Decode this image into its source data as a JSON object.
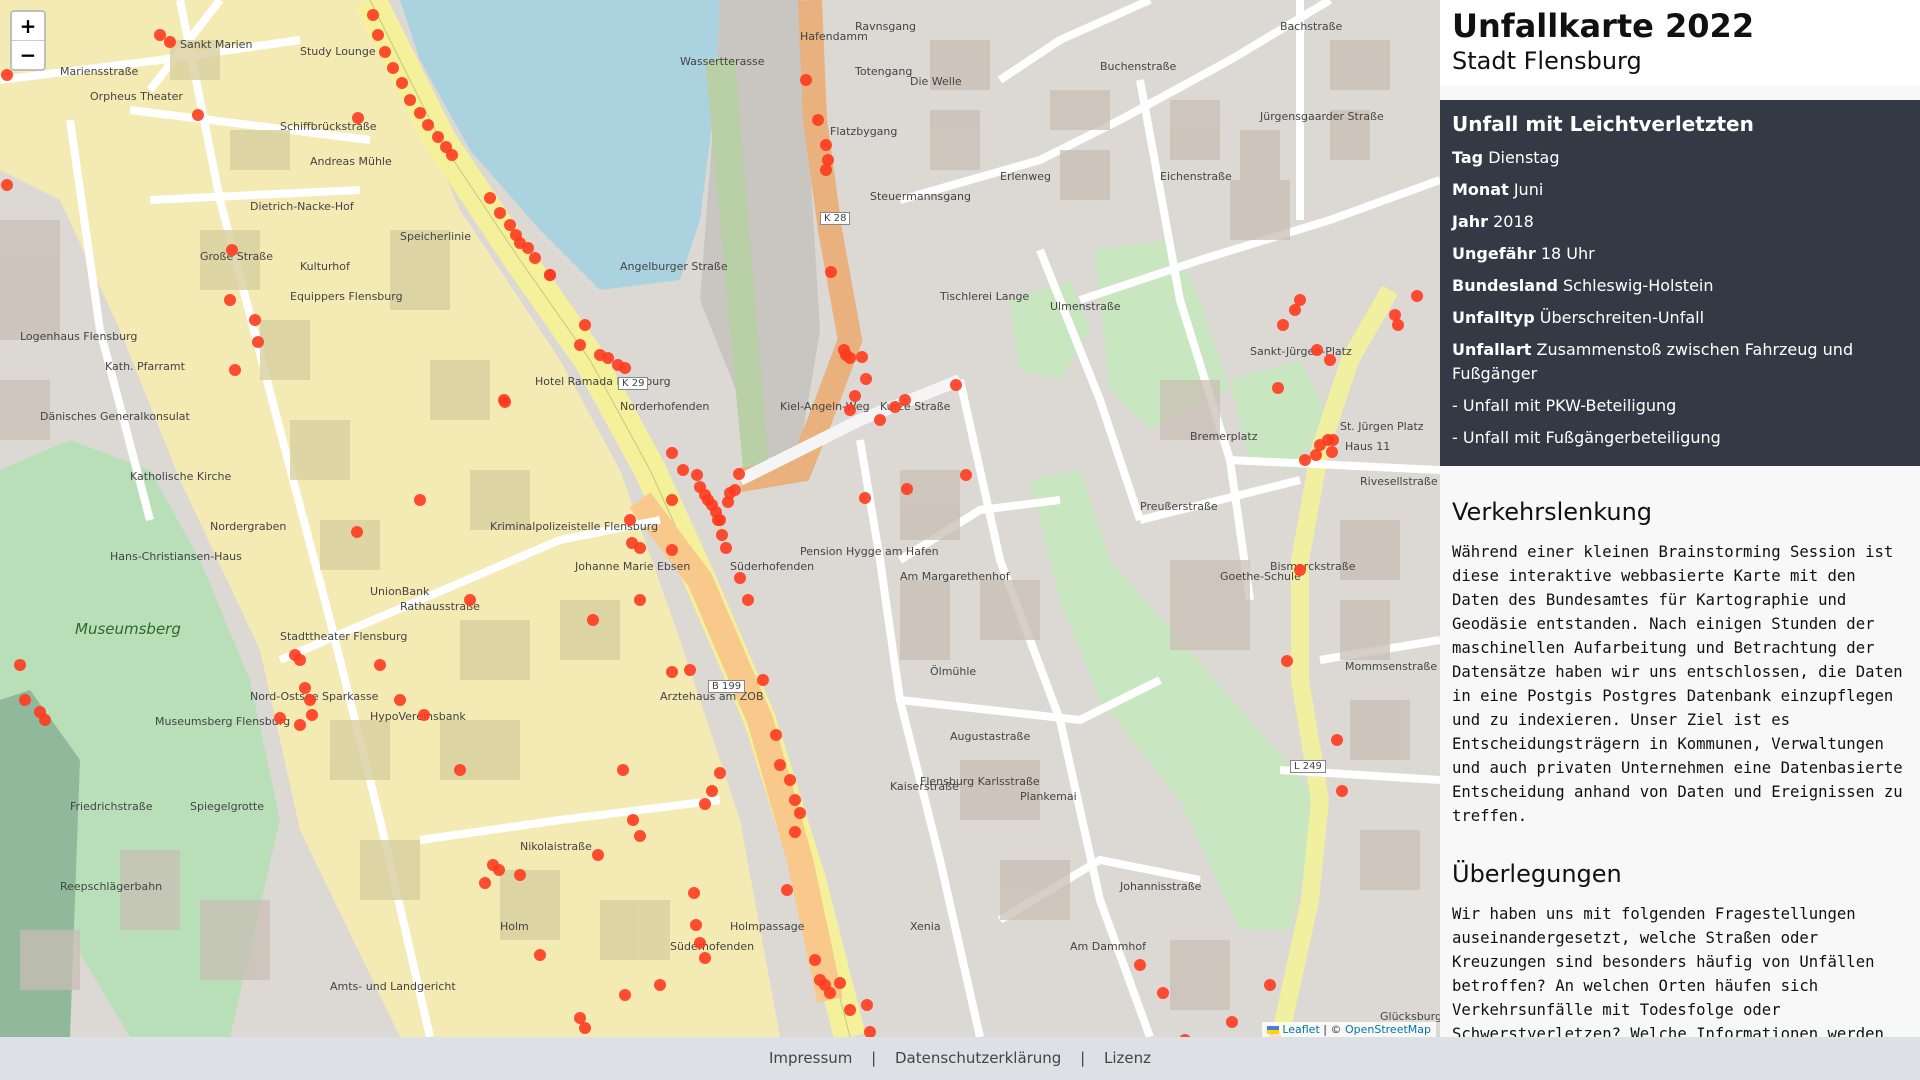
{
  "sidebar": {
    "title": "Unfallkarte 2022",
    "subtitle": "Stadt Flensburg",
    "info": {
      "heading": "Unfall mit Leichtverletzten",
      "rows": [
        {
          "label": "Tag",
          "value": "Dienstag"
        },
        {
          "label": "Monat",
          "value": "Juni"
        },
        {
          "label": "Jahr",
          "value": "2018"
        },
        {
          "label": "Ungefähr",
          "value": "18 Uhr"
        },
        {
          "label": "Bundesland",
          "value": "Schleswig-Holstein"
        },
        {
          "label": "Unfalltyp",
          "value": "Überschreiten-Unfall"
        },
        {
          "label": "Unfallart",
          "value": "Zusammenstoß zwischen Fahrzeug und Fußgänger"
        }
      ],
      "flags": [
        "- Unfall mit PKW-Beteiligung",
        "- Unfall mit Fußgängerbeteiligung"
      ]
    },
    "sections": [
      {
        "heading": "Verkehrslenkung",
        "text": "Während einer kleinen Brainstorming Session ist diese interaktive webbasierte Karte mit den Daten des Bundesamtes für Kartographie und Geodäsie entstanden. Nach einigen Stunden der maschinellen Aufarbeitung und Betrachtung der Datensätze haben wir uns entschlossen, die Daten in eine Postgis Postgres Datenbank einzupflegen und zu indexieren. Unser Ziel ist es Entscheidungsträgern in Kommunen, Verwaltungen und auch privaten Unternehmen eine Datenbasierte Entscheidung anhand von Daten und Ereignissen zu treffen."
      },
      {
        "heading": "Überlegungen",
        "text": "Wir haben uns mit folgenden Fragestellungen auseinandergesetzt, welche Straßen oder Kreuzungen sind besonders häufig von Unfällen betroffen? An welchen Orten häufen sich Verkehrsunfälle mit Todesfolge oder Schwerstverletzen? Welche Informationen werden"
      }
    ]
  },
  "map": {
    "zoom_in": "+",
    "zoom_out": "−",
    "attribution_leaflet": "Leaflet",
    "attribution_sep": " | © ",
    "attribution_osm": "OpenStreetMap",
    "marker_color": "#ff3b1f",
    "labels": [
      "Sankt Marien",
      "Museumsberg",
      "Hafendamm",
      "Norderhofenden",
      "Süderhofenden",
      "Rathausstraße",
      "Nikolaistraße",
      "Augustastraße",
      "Bismarckstraße",
      "Kurze Straße",
      "Ölmühle",
      "Goethe-Schule",
      "Ulmenstraße",
      "Preußerstraße",
      "Am Dammhof",
      "Plankemai",
      "Speicherlinie",
      "Große Straße",
      "Nordergraben",
      "Angelburger Straße",
      "Steuermannsgang",
      "Flatzbygang",
      "Johannisstraße",
      "Am Margarethenhof",
      "Kaiserstraße",
      "Jürgensgaarder Straße",
      "Holm",
      "Schiffbrückstraße",
      "Dietrich-Nacke-Hof",
      "Logenhaus Flensburg",
      "Kath. Pfarramt",
      "Equippers Flensburg",
      "UnionBank",
      "HypoVereinsbank",
      "Arztehaus am ZOB",
      "Holmpassage",
      "Nord-Ostsee Sparkasse",
      "Stadttheater Flensburg",
      "Spiegelgrotte",
      "Friedrichstraße",
      "Mariensstraße",
      "Tischlerei Lange",
      "Pension Hygge am Hafen",
      "Andreas Mühle",
      "Kulturhof",
      "Bremerplatz",
      "Eichenstraße",
      "Buchenstraße",
      "Bachstraße",
      "Totengang",
      "Die Welle",
      "Ravnsgang",
      "Kiel-Angeln-Weg",
      "Erlenweg",
      "Mommsenstraße",
      "Kriminalpolizeistelle Flensburg",
      "Johanne Marie Ebsen",
      "Museumsberg Flensburg",
      "Hans-Christiansen-Haus",
      "Wassertterasse",
      "Hotel Ramada Flensburg",
      "Katholische Kirche",
      "Dänisches Generalkonsulat",
      "Amts- und Landgericht",
      "Xenia",
      "Study Lounge",
      "Orpheus Theater",
      "Flensburg Karlsstraße",
      "Sankt-Jürgen-Platz",
      "St. Jürgen Platz",
      "Haus 11",
      "Rivesellstraße",
      "Glücksburger Straße",
      "Reepschlägerbahn",
      "Süderhofenden"
    ],
    "road_refs": [
      "K 28",
      "K 29",
      "L 249",
      "B 199"
    ]
  },
  "footer": {
    "links": [
      "Impressum",
      "Datenschutzerklärung",
      "Lizenz"
    ],
    "sep": "|"
  }
}
